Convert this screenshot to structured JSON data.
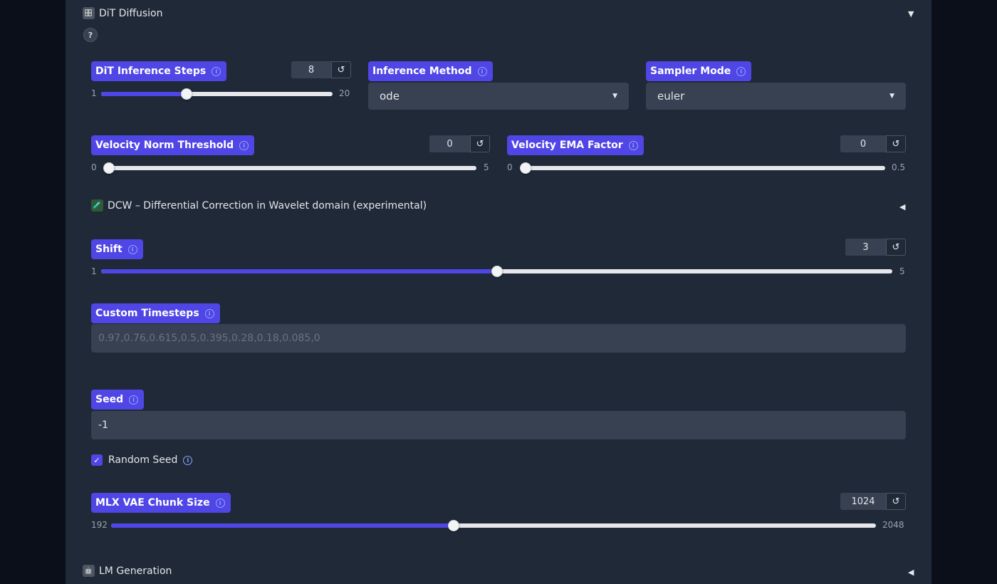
{
  "sections": {
    "dit": {
      "emoji": "🎛️",
      "title": "DiT Diffusion",
      "caret": "▼"
    },
    "dcw": {
      "emoji": "🧪",
      "title": "DCW – Differential Correction in Wavelet domain (experimental)",
      "caret": "◀"
    },
    "lm": {
      "emoji": "🤖",
      "title": "LM Generation",
      "caret": "◀"
    }
  },
  "help_label": "?",
  "info_glyph": "i",
  "reset_glyph": "↺",
  "dropdown_arrow": "▼",
  "check_glyph": "✓",
  "fields": {
    "inference_steps": {
      "label": "DiT Inference Steps",
      "value": "8",
      "min": "1",
      "max": "20",
      "level": 0.3684
    },
    "inference_method": {
      "label": "Inference Method",
      "value": "ode"
    },
    "sampler_mode": {
      "label": "Sampler Mode",
      "value": "euler"
    },
    "velocity_norm": {
      "label": "Velocity Norm Threshold",
      "value": "0",
      "min": "0",
      "max": "5",
      "level": 0
    },
    "velocity_ema": {
      "label": "Velocity EMA Factor",
      "value": "0",
      "min": "0",
      "max": "0.5",
      "level": 0
    },
    "shift": {
      "label": "Shift",
      "value": "3",
      "min": "1",
      "max": "5",
      "level": 0.5
    },
    "custom_timesteps": {
      "label": "Custom Timesteps",
      "placeholder": "0.97,0.76,0.615,0.5,0.395,0.28,0.18,0.085,0"
    },
    "seed": {
      "label": "Seed",
      "value": "-1"
    },
    "random_seed": {
      "label": "Random Seed",
      "checked": true
    },
    "vae_chunk": {
      "label": "MLX VAE Chunk Size",
      "value": "1024",
      "min": "192",
      "max": "2048",
      "level": 0.4483
    }
  },
  "colors": {
    "accent": "#4f46e5",
    "panel": "#1f2937",
    "input": "#374151",
    "page": "#0b0f19"
  }
}
